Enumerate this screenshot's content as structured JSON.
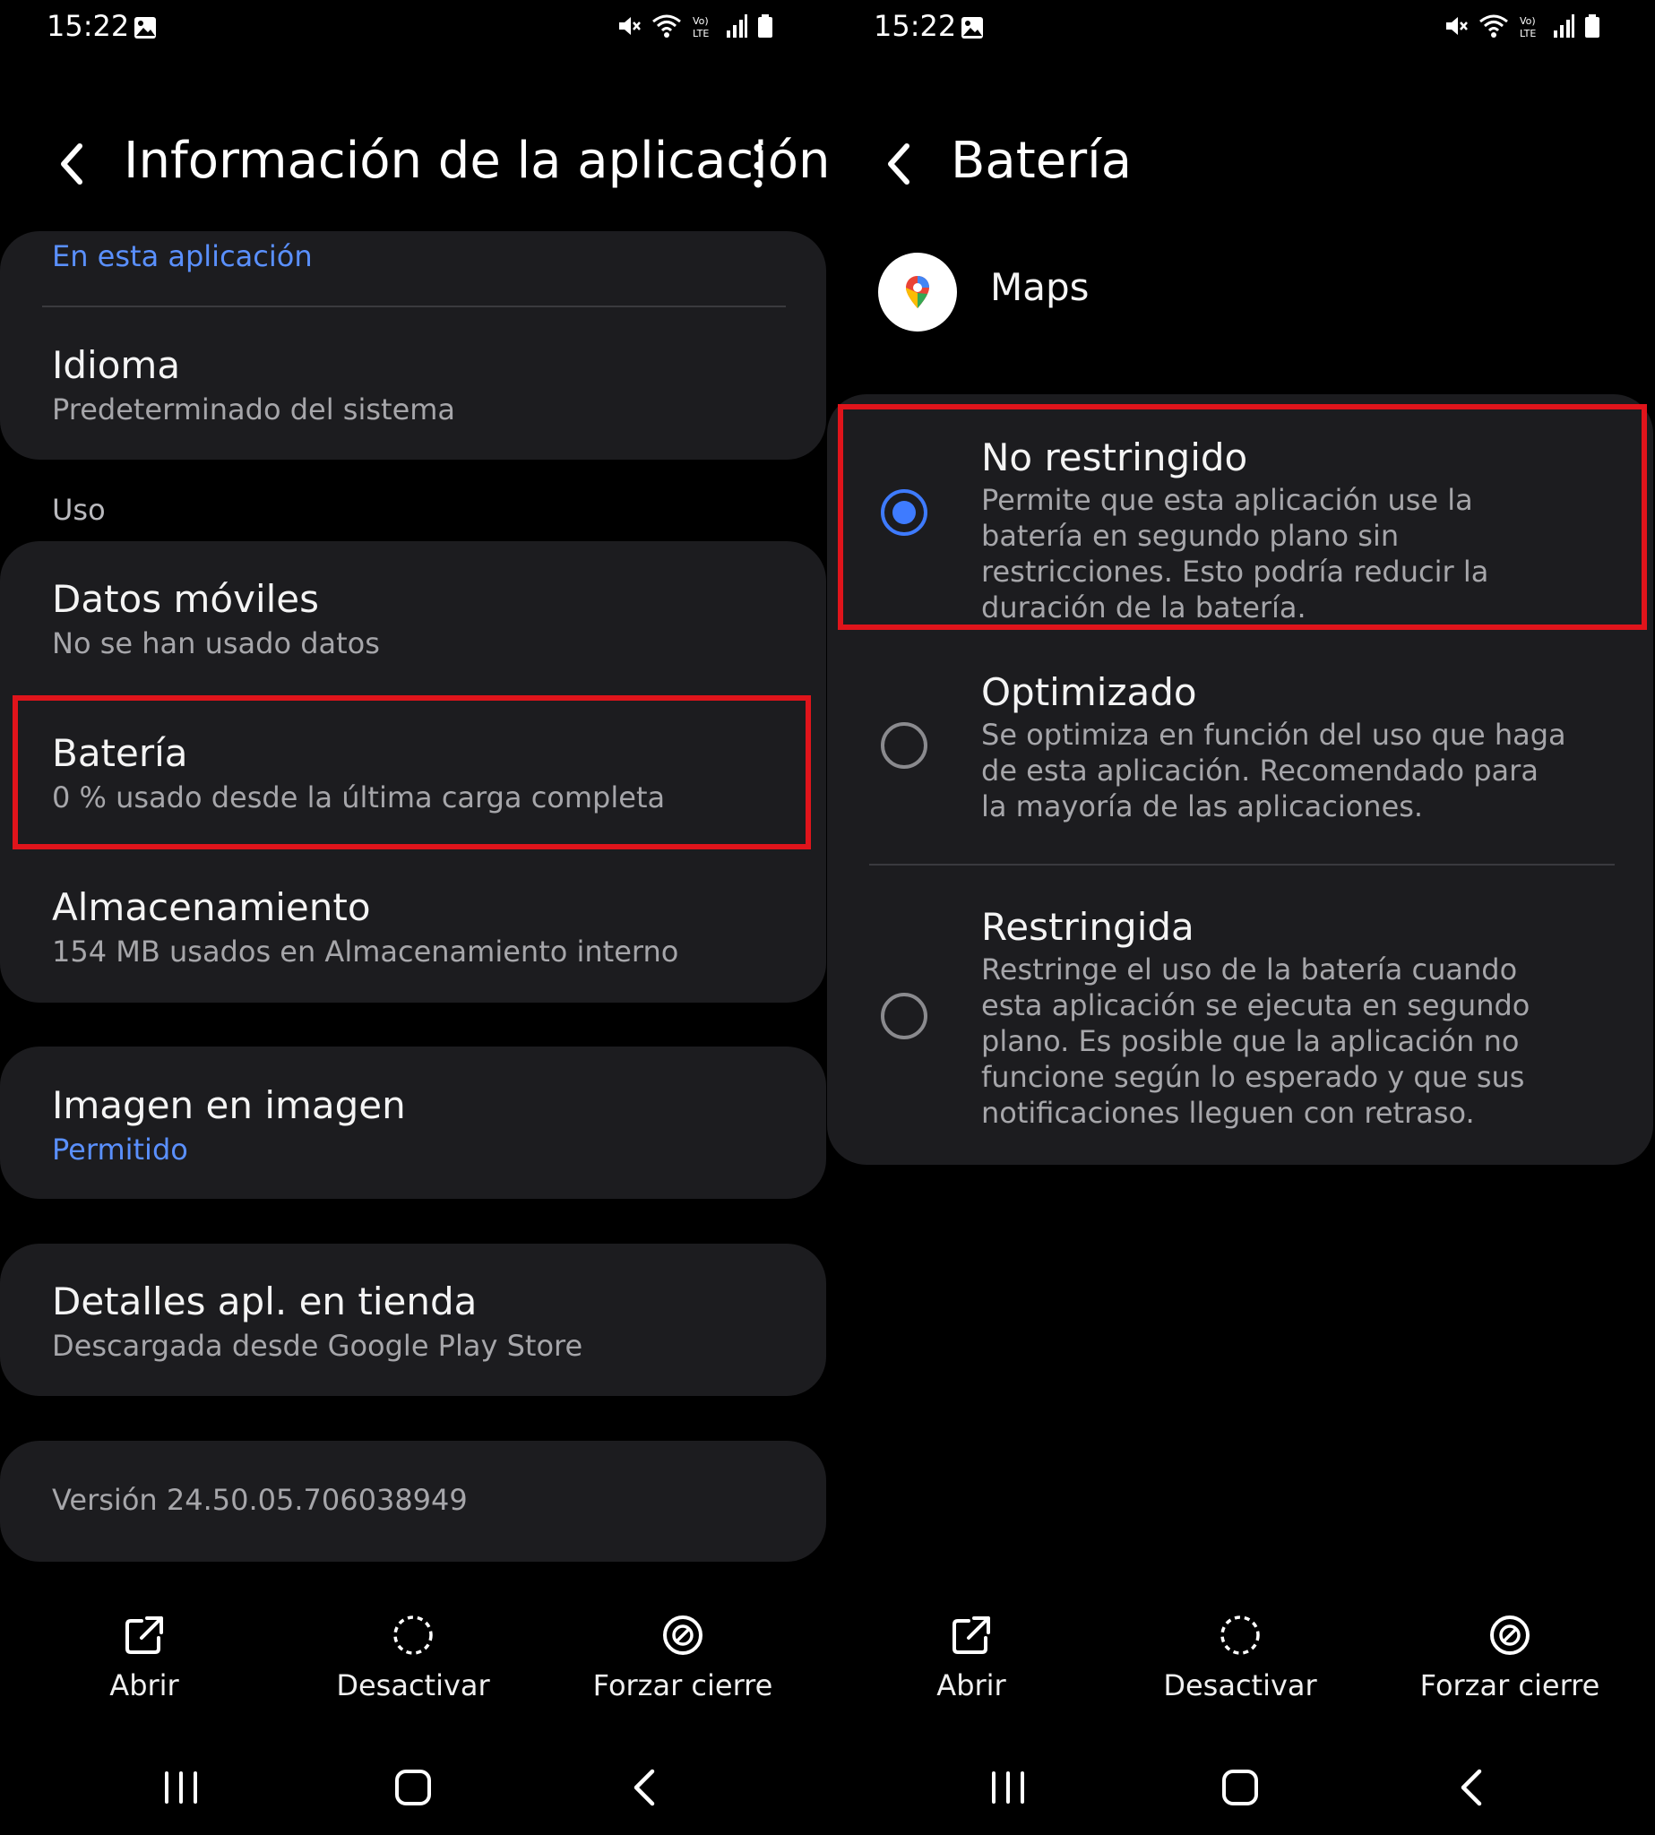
{
  "status": {
    "time": "15:22"
  },
  "left": {
    "title": "Información de la aplicación",
    "top_link": "En esta aplicación",
    "language": {
      "title": "Idioma",
      "subtitle": "Predeterminado del sistema"
    },
    "section_usage": "Uso",
    "mobile_data": {
      "title": "Datos móviles",
      "subtitle": "No se han usado datos"
    },
    "battery": {
      "title": "Batería",
      "subtitle": "0 % usado desde la última carga completa"
    },
    "storage": {
      "title": "Almacenamiento",
      "subtitle": "154 MB usados en Almacenamiento interno"
    },
    "pip": {
      "title": "Imagen en imagen",
      "subtitle": "Permitido"
    },
    "store": {
      "title": "Detalles apl. en tienda",
      "subtitle": "Descargada desde Google Play Store"
    },
    "version": "Versión 24.50.05.706038949"
  },
  "right": {
    "title": "Batería",
    "app_name": "Maps",
    "options": [
      {
        "title": "No restringido",
        "desc": "Permite que esta aplicación use la batería en segundo plano sin restricciones. Esto podría reducir la duración de la batería.",
        "selected": true
      },
      {
        "title": "Optimizado",
        "desc": "Se optimiza en función del uso que haga de esta aplicación. Recomendado para la mayoría de las aplicaciones.",
        "selected": false
      },
      {
        "title": "Restringida",
        "desc": "Restringe el uso de la batería cuando esta aplicación se ejecuta en segundo plano. Es posible que la aplicación no funcione según lo esperado y que sus notificaciones lleguen con retraso.",
        "selected": false
      }
    ]
  },
  "actions": {
    "open": "Abrir",
    "disable": "Desactivar",
    "force_stop": "Forzar cierre"
  },
  "colors": {
    "accent": "#3e7bff",
    "link": "#5a90ff",
    "highlight": "#e0141b",
    "card": "#1c1c1f"
  },
  "icons": [
    "back-icon",
    "more-icon",
    "open-icon",
    "disable-icon",
    "force-stop-icon",
    "recents-icon",
    "home-icon",
    "nav-back-icon",
    "maps-logo-icon"
  ]
}
